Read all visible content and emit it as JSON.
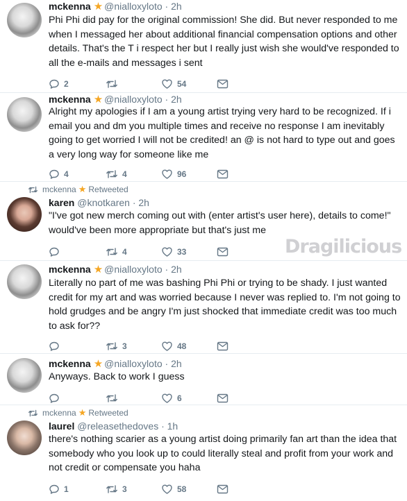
{
  "tweets": [
    {
      "name": "mckenna",
      "handle": "@nialloxyloto",
      "time": "· 2h",
      "text": "Phi Phi did pay for the original commission! She did. But never responded to me when I messaged her about additional financial compensation options and other details. That's the T i respect her but I really just wish she would've responded to all the e-mails and messages i sent",
      "replies": "2",
      "retweets": "",
      "likes": "54"
    },
    {
      "name": "mckenna",
      "handle": "@nialloxyloto",
      "time": "· 2h",
      "text": "Alright my apologies if I am a young artist trying very hard to be recognized. If i email you and dm you multiple times and receive no response I am inevitably going to get worried I will not be credited! an @ is not hard to type out and goes a very long way for someone like me",
      "replies": "4",
      "retweets": "4",
      "likes": "96"
    },
    {
      "retweeted_by": "mckenna",
      "retweeted_label": "Retweeted",
      "name": "karen",
      "handle": "@knotkaren",
      "time": "· 2h",
      "text": "\"I've got new merch coming out with (enter artist's user here), details to come!\" would've been more appropriate but that's just me",
      "replies": "",
      "retweets": "4",
      "likes": "33"
    },
    {
      "name": "mckenna",
      "handle": "@nialloxyloto",
      "time": "· 2h",
      "text": "Literally no part of me was bashing Phi Phi or trying to be shady. I just wanted credit for my art and was worried because I never was replied to. I'm not going to hold grudges and be angry I'm just shocked that immediate credit was too much to ask for??",
      "replies": "",
      "retweets": "3",
      "likes": "48"
    },
    {
      "name": "mckenna",
      "handle": "@nialloxyloto",
      "time": "· 2h",
      "text": "Anyways. Back to work I guess",
      "replies": "",
      "retweets": "",
      "likes": "6"
    },
    {
      "retweeted_by": "mckenna",
      "retweeted_label": "Retweeted",
      "name": "laurel",
      "handle": "@releasethedoves",
      "time": "· 1h",
      "text": "there's nothing scarier as a young artist doing primarily fan art than the idea that somebody who you look up to could literally steal and profit from your work and not credit or compensate you haha",
      "replies": "1",
      "retweets": "3",
      "likes": "58"
    }
  ],
  "watermark": "Dragilicious",
  "colors": {
    "star": "#f5a623",
    "muted": "#657786",
    "text": "#14171a",
    "divider": "#e6ecf0"
  }
}
